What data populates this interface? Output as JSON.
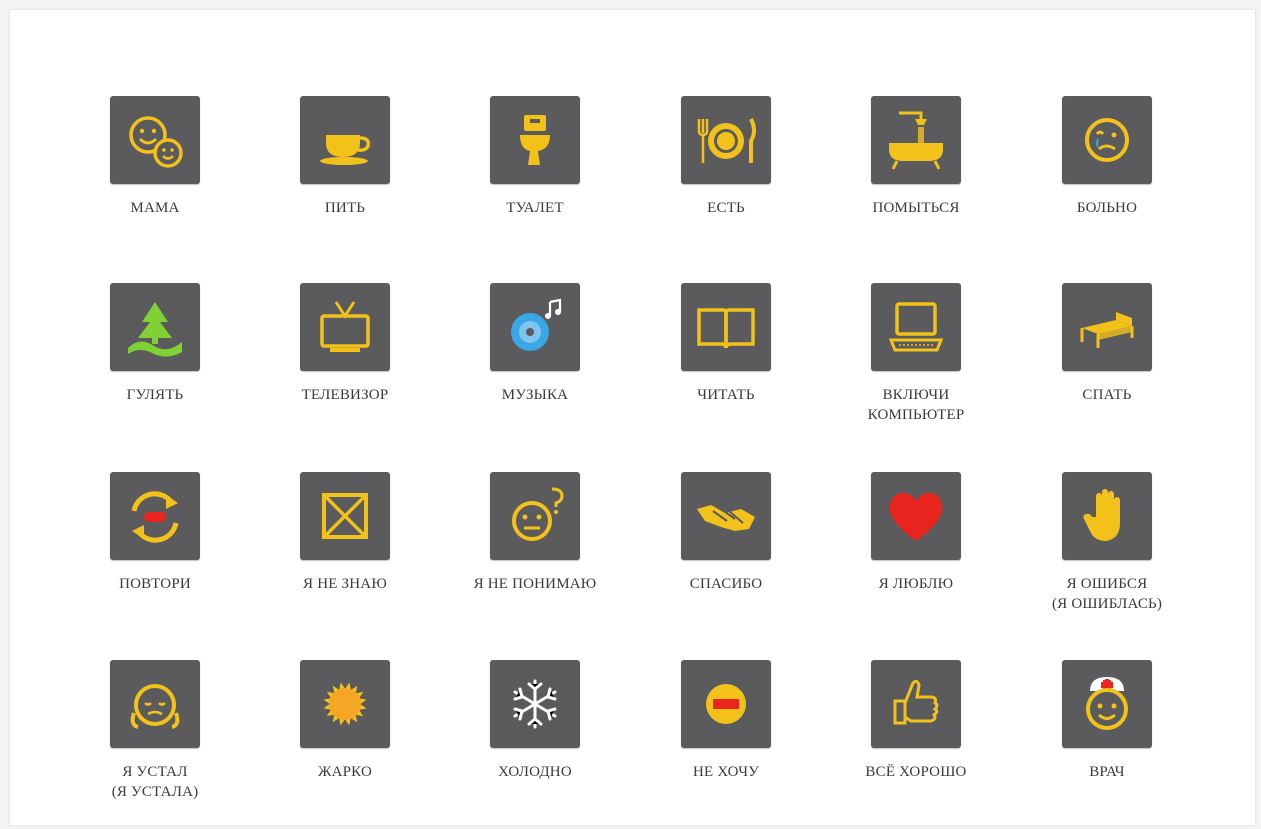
{
  "colors": {
    "tile_bg": "#5b5b5d",
    "icon_yellow": "#f2c21b",
    "icon_green": "#7fd136",
    "icon_blue": "#3aa7e6",
    "icon_red": "#e8251f",
    "label_text": "#3a3a3a"
  },
  "rows": [
    {
      "cards": [
        {
          "icon": "mother-child-faces-icon",
          "label": [
            "МАМА"
          ]
        },
        {
          "icon": "cup-icon",
          "label": [
            "ПИТЬ"
          ]
        },
        {
          "icon": "toilet-icon",
          "label": [
            "ТУАЛЕТ"
          ]
        },
        {
          "icon": "plate-fork-knife-icon",
          "label": [
            "ЕСТЬ"
          ]
        },
        {
          "icon": "bathtub-shower-icon",
          "label": [
            "ПОМЫТЬСЯ"
          ]
        },
        {
          "icon": "sick-face-icon",
          "label": [
            "БОЛЬНО"
          ]
        }
      ]
    },
    {
      "cards": [
        {
          "icon": "tree-path-icon",
          "label": [
            "ГУЛЯТЬ"
          ]
        },
        {
          "icon": "tv-icon",
          "label": [
            "ТЕЛЕВИЗОР"
          ]
        },
        {
          "icon": "cd-music-icon",
          "label": [
            "МУЗЫКА"
          ]
        },
        {
          "icon": "open-book-icon",
          "label": [
            "ЧИТАТЬ"
          ]
        },
        {
          "icon": "laptop-icon",
          "label": [
            "ВКЛЮЧИ",
            "КОМПЬЮТЕР"
          ]
        },
        {
          "icon": "bed-icon",
          "label": [
            "СПАТЬ"
          ]
        }
      ]
    },
    {
      "cards": [
        {
          "icon": "repeat-arrows-icon",
          "label": [
            "ПОВТОРИ"
          ]
        },
        {
          "icon": "crossed-box-icon",
          "label": [
            "Я НЕ ЗНАЮ"
          ]
        },
        {
          "icon": "confused-face-icon",
          "label": [
            "Я НЕ ПОНИМАЮ"
          ]
        },
        {
          "icon": "handshake-icon",
          "label": [
            "СПАСИБО"
          ]
        },
        {
          "icon": "heart-icon",
          "label": [
            "Я ЛЮБЛЮ"
          ]
        },
        {
          "icon": "raised-hand-icon",
          "label": [
            "Я ОШИБСЯ",
            "(Я ОШИБЛАСЬ)"
          ]
        }
      ]
    },
    {
      "cards": [
        {
          "icon": "tired-face-icon",
          "label": [
            "Я УСТАЛ",
            "(Я УСТАЛА)"
          ]
        },
        {
          "icon": "sun-icon",
          "label": [
            "ЖАРКО"
          ]
        },
        {
          "icon": "snowflake-icon",
          "label": [
            "ХОЛОДНО"
          ]
        },
        {
          "icon": "no-entry-icon",
          "label": [
            "НЕ ХОЧУ"
          ]
        },
        {
          "icon": "thumbs-up-icon",
          "label": [
            "ВСЁ ХОРОШО"
          ]
        },
        {
          "icon": "doctor-face-icon",
          "label": [
            "ВРАЧ"
          ]
        }
      ]
    }
  ]
}
